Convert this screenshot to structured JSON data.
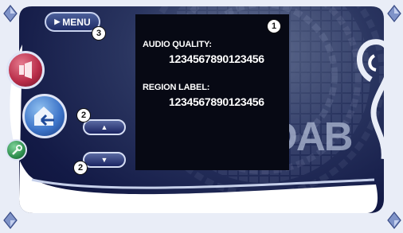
{
  "menu_button": {
    "label": "MENU"
  },
  "panel": {
    "audio_quality_label": "AUDIO QUALITY:",
    "audio_quality_value": "1234567890123456",
    "region_label_label": "REGION LABEL:",
    "region_label_value": "1234567890123456"
  },
  "callouts": {
    "panel": "1",
    "up": "2",
    "down": "2",
    "menu": "3"
  },
  "watermark": "DAB",
  "icons": {
    "menu_triangle": "play-triangle-icon",
    "left_round_1": "source-icon",
    "left_round_2": "return-home-icon",
    "left_round_3": "tool-icon",
    "up_button": "up-arrow-icon",
    "down_button": "down-arrow-icon",
    "corner_top_left": "scroll-up-icon",
    "corner_top_right": "scroll-up-icon",
    "corner_bottom_left": "scroll-down-icon",
    "corner_bottom_right": "scroll-down-icon"
  },
  "colors": {
    "background": "#131a46",
    "frame": "#e9edf7",
    "panel": "#070914",
    "accent_red": "#b82c48",
    "accent_blue": "#3d74c8",
    "accent_green": "#2f8f4e"
  }
}
